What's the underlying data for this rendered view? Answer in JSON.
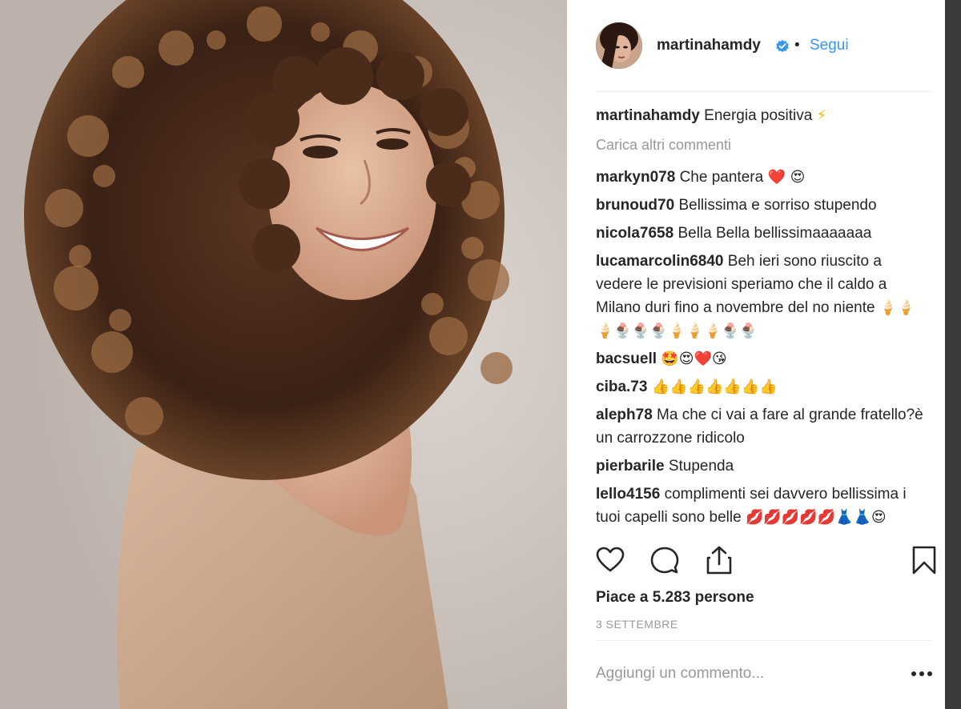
{
  "post": {
    "username": "martinahamdy",
    "separator": "•",
    "follow_label": "Segui",
    "caption_user": "martinahamdy",
    "caption_text": "Energia positiva",
    "caption_emoji": "⚡",
    "load_more": "Carica altri commenti",
    "comments": [
      {
        "user": "markyn078",
        "text": "Che pantera",
        "emoji": "❤️ 😍"
      },
      {
        "user": "brunoud70",
        "text": "Bellissima e sorriso stupendo",
        "emoji": ""
      },
      {
        "user": "nicola7658",
        "text": "Bella Bella bellissimaaaaaaa",
        "emoji": ""
      },
      {
        "user": "lucamarcolin6840",
        "text": "Beh ieri sono riuscito a vedere le previsioni speriamo che il caldo a Milano duri fino a novembre del no niente",
        "emoji": "🍦🍦🍦🍨🍨🍨🍦🍦🍦🍨🍨"
      },
      {
        "user": "bacsuell",
        "text": "",
        "emoji": "🤩😍❤️😘"
      },
      {
        "user": "ciba.73",
        "text": "",
        "emoji": "👍👍👍👍👍👍👍"
      },
      {
        "user": "aleph78",
        "text": "Ma che ci vai a fare al grande fratello?è un carrozzone ridicolo",
        "emoji": ""
      },
      {
        "user": "pierbarile",
        "text": "Stupenda",
        "emoji": ""
      },
      {
        "user": "lello4156",
        "text": "complimenti sei davvero bellissima i tuoi capelli sono belle",
        "emoji": "💋💋💋💋💋👗👗😍"
      }
    ],
    "likes": "Piace a 5.283 persone",
    "date": "3 SETTEMBRE",
    "comment_placeholder": "Aggiungi un commento...",
    "more_label": "•••"
  },
  "icons": [
    "heart-icon",
    "comment-icon",
    "share-icon",
    "bookmark-icon",
    "verified-badge-icon",
    "more-options-icon"
  ],
  "colors": {
    "link": "#3897f0",
    "muted": "#999999",
    "text": "#262626",
    "verified": "#3897f0"
  }
}
